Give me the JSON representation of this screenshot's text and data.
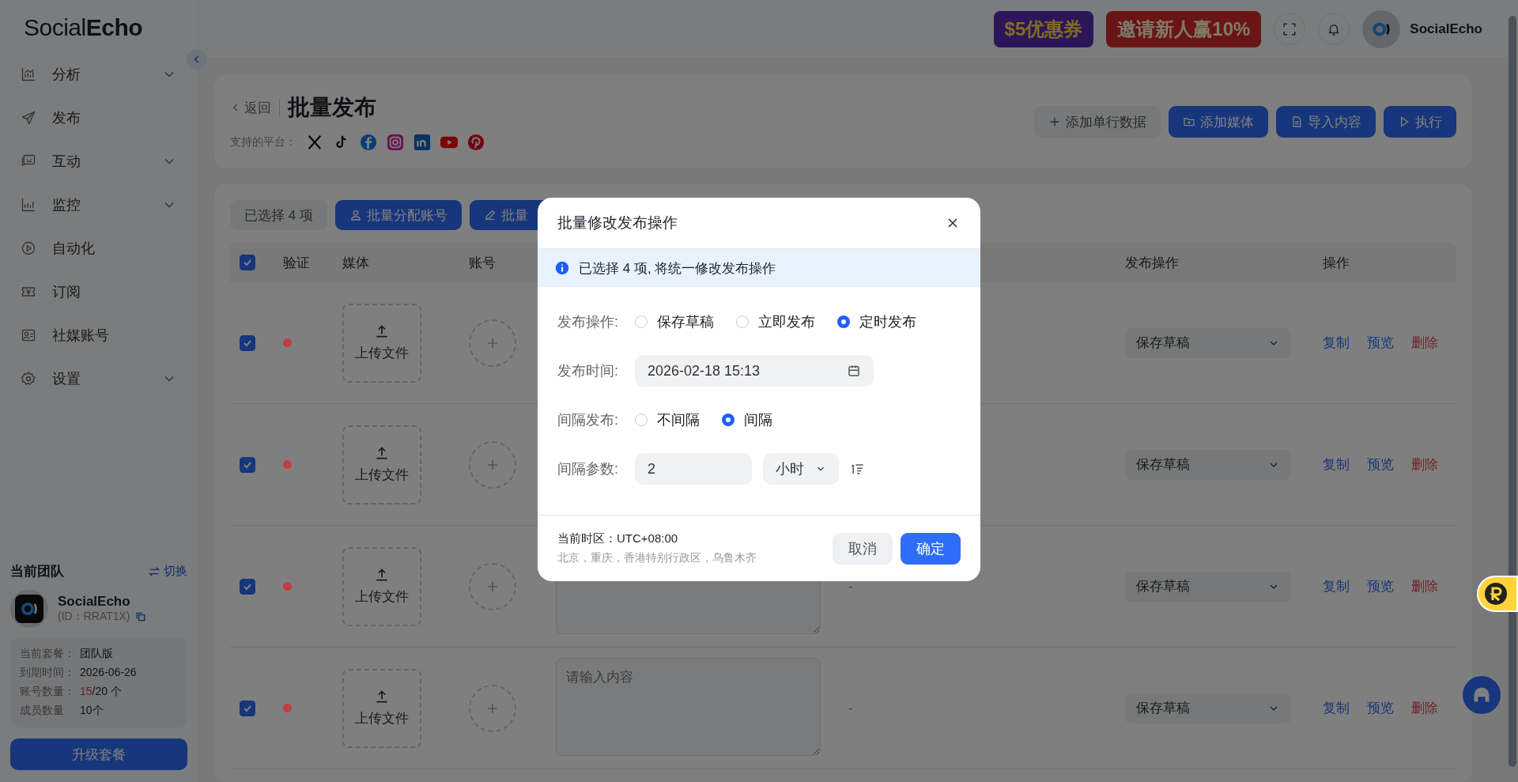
{
  "brand": {
    "logo": "Social**Echo**"
  },
  "sidebar": {
    "items": [
      {
        "label": "分析",
        "expandable": true
      },
      {
        "label": "发布",
        "expandable": false
      },
      {
        "label": "互动",
        "expandable": true
      },
      {
        "label": "监控",
        "expandable": true
      },
      {
        "label": "自动化",
        "expandable": false
      },
      {
        "label": "订阅",
        "expandable": false
      },
      {
        "label": "社媒账号",
        "expandable": false
      },
      {
        "label": "设置",
        "expandable": true
      }
    ]
  },
  "team": {
    "title": "当前团队",
    "switch": "切换",
    "name": "SocialEcho",
    "id": "(ID：RRAT1X)",
    "plan": [
      {
        "label": "当前套餐：",
        "value": "团队版"
      },
      {
        "label": "到期时间：",
        "value": "2026-06-26"
      },
      {
        "label": "账号数量：",
        "highlight": "15",
        "value": "/20 个"
      },
      {
        "label": "成员数量",
        "value": "10个"
      }
    ],
    "upgrade": "升级套餐"
  },
  "topbar": {
    "banners": [
      {
        "label": "$5优惠券",
        "kind": "coupon"
      },
      {
        "label": "邀请新人赢10%",
        "kind": "invite"
      }
    ],
    "user": "SocialEcho"
  },
  "header": {
    "back": "返回",
    "title": "批量发布",
    "platforms_label": "支持的平台：",
    "buttons": [
      {
        "label": "添加单行数据",
        "kind": "secondary"
      },
      {
        "label": "添加媒体",
        "kind": "media"
      },
      {
        "label": "导入内容",
        "kind": "import"
      },
      {
        "label": "执行",
        "kind": "run"
      }
    ]
  },
  "toolbar": {
    "selected": "已选择 4 项",
    "buttons": [
      "批量分配账号",
      "批量"
    ]
  },
  "table": {
    "header_checked": true,
    "columns": [
      "验证",
      "媒体",
      "账号",
      "发布操作",
      "操作"
    ],
    "rows": [
      {
        "checked": true,
        "color": "#c43c44",
        "upload": "上传文件",
        "publish_action": "保存草稿",
        "actions": [
          {
            "label": "复制",
            "kind": "link"
          },
          {
            "label": "预览",
            "kind": "link"
          },
          {
            "label": "删除",
            "kind": "danger"
          }
        ]
      },
      {
        "checked": true,
        "color": "#c43c44",
        "upload": "上传文件",
        "publish_action": "保存草稿",
        "actions": [
          {
            "label": "复制",
            "kind": "link"
          },
          {
            "label": "预览",
            "kind": "link"
          },
          {
            "label": "删除",
            "kind": "danger"
          }
        ]
      },
      {
        "checked": true,
        "color": "#c43c44",
        "upload": "上传文件",
        "dash": "-",
        "publish_action": "保存草稿",
        "actions": [
          {
            "label": "复制",
            "kind": "link"
          },
          {
            "label": "预览",
            "kind": "link"
          },
          {
            "label": "删除",
            "kind": "danger"
          }
        ]
      },
      {
        "checked": true,
        "color": "#c43c44",
        "upload": "上传文件",
        "placeholder": "请输入内容",
        "dash": "-",
        "publish_action": "保存草稿",
        "actions": [
          {
            "label": "复制",
            "kind": "link"
          },
          {
            "label": "预览",
            "kind": "link"
          },
          {
            "label": "删除",
            "kind": "danger"
          }
        ]
      }
    ]
  },
  "dialog": {
    "title": "批量修改发布操作",
    "info": "已选择 4 项, 将统一修改发布操作",
    "publish_action": {
      "label": "发布操作:",
      "options": [
        {
          "label": "保存草稿",
          "selected": false
        },
        {
          "label": "立即发布",
          "selected": false
        },
        {
          "label": "定时发布",
          "selected": true
        }
      ]
    },
    "publish_time": {
      "label": "发布时间:",
      "value": "2026-02-18 15:13"
    },
    "interval": {
      "label": "间隔发布:",
      "options": [
        {
          "label": "不间隔",
          "selected": false
        },
        {
          "label": "间隔",
          "selected": true
        }
      ]
    },
    "interval_params": {
      "label": "间隔参数:",
      "value": "2",
      "unit": "小时"
    },
    "timezone": "当前时区：UTC+08:00",
    "cities": "北京，重庆，香港特别行政区，乌鲁木齐",
    "cancel": "取消",
    "confirm": "确定"
  }
}
